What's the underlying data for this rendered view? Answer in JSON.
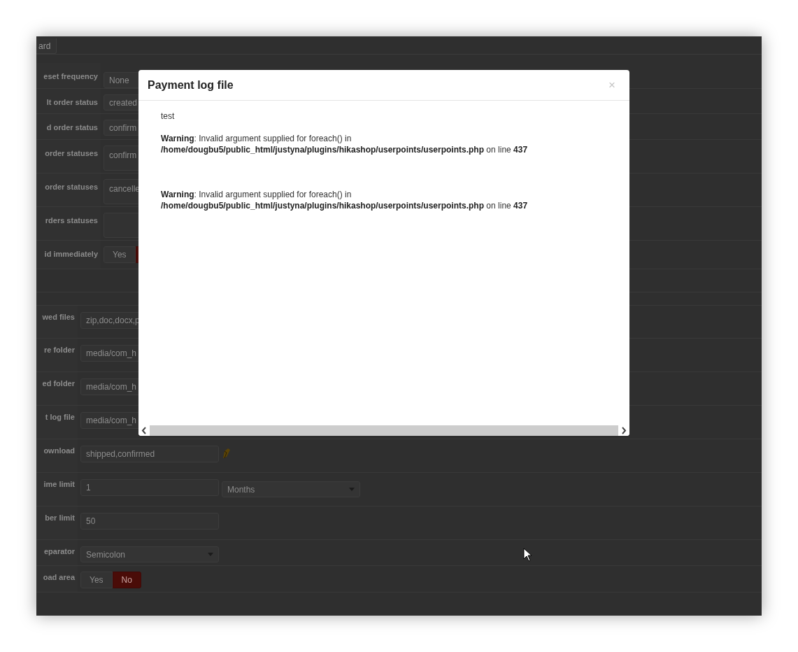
{
  "background_form": {
    "top_button": "ard",
    "sections": [
      {
        "rows": [
          {
            "label": "eset frequency",
            "kind": "select",
            "value": "None"
          },
          {
            "label": "lt order status",
            "kind": "select",
            "value": "created"
          },
          {
            "label": "d order status",
            "kind": "select",
            "value": "confirm"
          },
          {
            "label": "order statuses",
            "kind": "tall",
            "value": "confirm"
          },
          {
            "label": "order statuses",
            "kind": "tall",
            "value": "cancelle"
          },
          {
            "label": "rders statuses",
            "kind": "tall"
          },
          {
            "label": "id immediately",
            "kind": "toggle",
            "options": [
              {
                "label": "Yes",
                "selected": false
              },
              {
                "selected": true
              }
            ]
          }
        ]
      },
      {
        "rows": [
          {
            "label": "wed files",
            "kind": "input",
            "value": "zip,doc,docx,p"
          },
          {
            "label": "re folder",
            "kind": "input",
            "value": "media/com_h"
          },
          {
            "label": "ed folder",
            "kind": "input",
            "value": "media/com_h"
          },
          {
            "label": "t log file",
            "kind": "input_button",
            "value": "media/com_h"
          },
          {
            "label": "ownload",
            "kind": "input_icon",
            "value": "shipped,confirmed"
          },
          {
            "label": "ime limit",
            "kind": "input_select",
            "value": "1",
            "select": "Months"
          },
          {
            "label": "ber limit",
            "kind": "input",
            "value": "50"
          },
          {
            "label": "eparator",
            "kind": "select",
            "value": "Semicolon"
          },
          {
            "label": "oad area",
            "kind": "toggle",
            "options": [
              {
                "label": "Yes",
                "selected": false
              },
              {
                "label": "No",
                "selected": true
              }
            ]
          }
        ]
      }
    ]
  },
  "modal": {
    "title": "Payment log file",
    "close": "×",
    "blocks": [
      {
        "lines": [
          "test"
        ]
      },
      {
        "lines": [
          "**Warning**: Invalid argument supplied for foreach() in",
          "**/home/dougbu5/public_html/justyna/plugins/hikashop/userpoints/userpoints.php** on line **437**"
        ]
      },
      {
        "lines": [
          "**Warning**: Invalid argument supplied for foreach() in",
          "**/home/dougbu5/public_html/justyna/plugins/hikashop/userpoints/userpoints.php** on line **437**"
        ]
      }
    ]
  }
}
